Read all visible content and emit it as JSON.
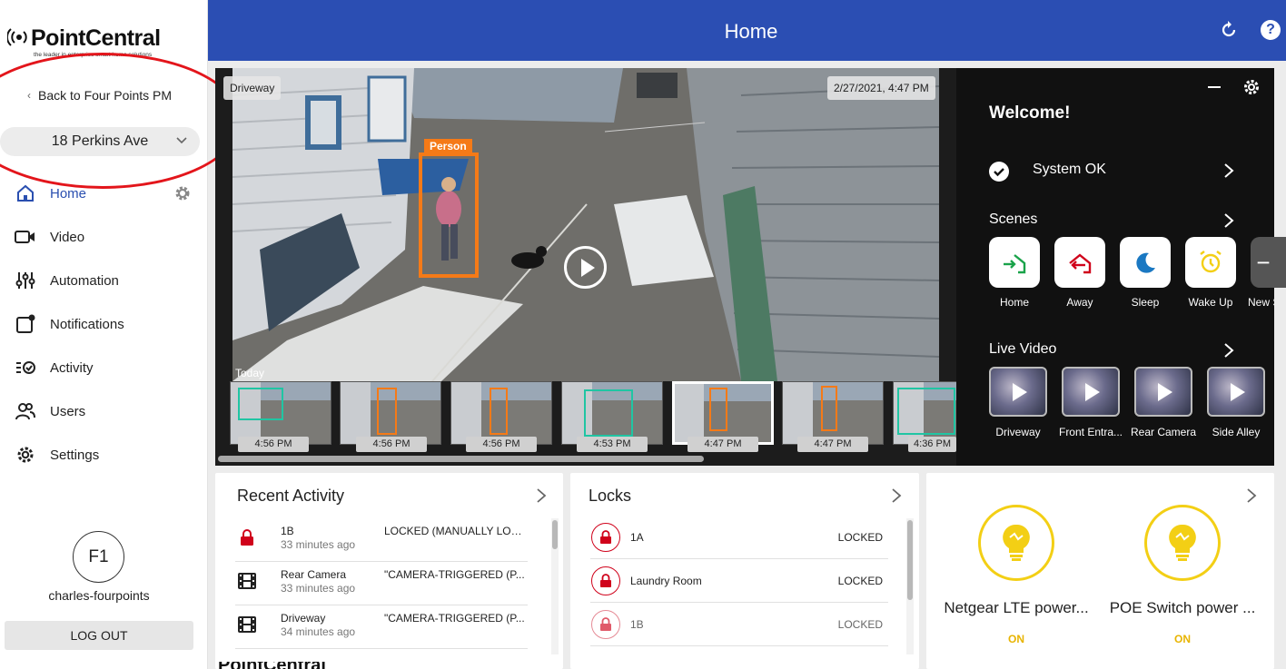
{
  "sidebar": {
    "logo": {
      "brand": "PointCentral",
      "tagline": "the leader in enterprise smart home solutions"
    },
    "back_link": "Back to Four Points PM",
    "property": "18 Perkins Ave",
    "nav": [
      {
        "label": "Home",
        "icon": "home-icon"
      },
      {
        "label": "Video",
        "icon": "video-camera-icon"
      },
      {
        "label": "Automation",
        "icon": "sliders-icon"
      },
      {
        "label": "Notifications",
        "icon": "notification-icon"
      },
      {
        "label": "Activity",
        "icon": "activity-list-icon"
      },
      {
        "label": "Users",
        "icon": "users-icon"
      },
      {
        "label": "Settings",
        "icon": "gear-icon"
      }
    ],
    "user": {
      "initials": "F1",
      "name": "charles-fourpoints"
    },
    "logout": "LOG OUT"
  },
  "header": {
    "title": "Home"
  },
  "video": {
    "camera_name": "Driveway",
    "timestamp": "2/27/2021, 4:47 PM",
    "detection_label": "Person",
    "today_label": "Today",
    "thumbnails": [
      {
        "time": "4:56 PM",
        "box": "green"
      },
      {
        "time": "4:56 PM",
        "box": "orange"
      },
      {
        "time": "4:56 PM",
        "box": "orange"
      },
      {
        "time": "4:53 PM",
        "box": "green"
      },
      {
        "time": "4:47 PM",
        "box": "orange"
      },
      {
        "time": "4:47 PM",
        "box": "orange"
      },
      {
        "time": "4:36 PM",
        "box": "green"
      }
    ]
  },
  "welcome": {
    "title": "Welcome!",
    "system_status": "System OK",
    "scenes_label": "Scenes",
    "scenes": [
      {
        "label": "Home",
        "icon": "home-arrive-icon",
        "color": "#1aa34a"
      },
      {
        "label": "Away",
        "icon": "home-leave-icon",
        "color": "#d0021b"
      },
      {
        "label": "Sleep",
        "icon": "moon-icon",
        "color": "#1a78c2"
      },
      {
        "label": "Wake Up",
        "icon": "alarm-clock-icon",
        "color": "#f3cf15"
      },
      {
        "label": "New S",
        "icon": "add-icon",
        "color": "#555555"
      }
    ],
    "live_video_label": "Live Video",
    "live_cams": [
      "Driveway",
      "Front Entra...",
      "Rear Camera",
      "Side Alley"
    ]
  },
  "recent_activity": {
    "title": "Recent Activity",
    "rows": [
      {
        "name": "1B",
        "time": "33 minutes ago",
        "status": "LOCKED (MANUALLY LOC...",
        "icon": "lock-icon"
      },
      {
        "name": "Rear Camera",
        "time": "33 minutes ago",
        "status": "\"CAMERA-TRIGGERED (P...",
        "icon": "film-icon"
      },
      {
        "name": "Driveway",
        "time": "34 minutes ago",
        "status": "\"CAMERA-TRIGGERED (P...",
        "icon": "film-icon"
      }
    ]
  },
  "locks": {
    "title": "Locks",
    "rows": [
      {
        "name": "1A",
        "status": "LOCKED"
      },
      {
        "name": "Laundry Room",
        "status": "LOCKED"
      },
      {
        "name": "1B",
        "status": "LOCKED"
      }
    ]
  },
  "switches": [
    {
      "name": "Netgear LTE power...",
      "state": "ON"
    },
    {
      "name": "POE Switch power ...",
      "state": "ON"
    }
  ],
  "footer_ghost": "PointCentral",
  "colors": {
    "header": "#2b4eb3",
    "accent": "#2a4fb0",
    "lock_red": "#d0021b",
    "switch_yellow": "#f3cf15",
    "annotation": "#e3151b"
  }
}
